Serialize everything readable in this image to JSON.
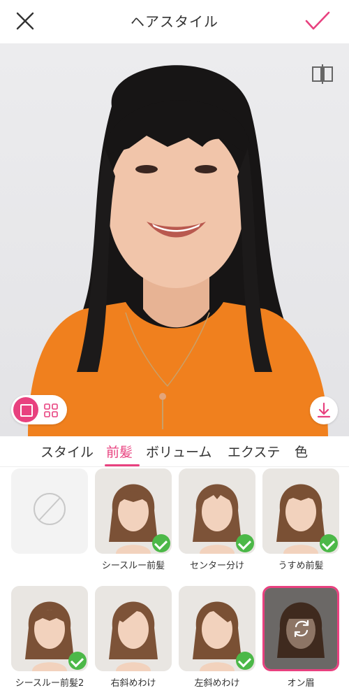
{
  "header": {
    "title": "ヘアスタイル"
  },
  "colors": {
    "accent": "#e8417f",
    "check": "#4cb848"
  },
  "tabs": [
    {
      "label": "スタイル",
      "active": false
    },
    {
      "label": "前髪",
      "active": true
    },
    {
      "label": "ボリューム",
      "active": false
    },
    {
      "label": "エクステ",
      "active": false
    },
    {
      "label": "色",
      "active": false
    }
  ],
  "styles": [
    {
      "label": "",
      "type": "none"
    },
    {
      "label": "シースルー前髪",
      "checked": true
    },
    {
      "label": "センター分け",
      "checked": true
    },
    {
      "label": "うすめ前髪",
      "checked": true
    },
    {
      "label": "シースルー前髪2",
      "checked": true
    },
    {
      "label": "右斜めわけ",
      "checked": false
    },
    {
      "label": "左斜めわけ",
      "checked": true
    },
    {
      "label": "オン眉",
      "checked": false,
      "selected": true
    }
  ]
}
